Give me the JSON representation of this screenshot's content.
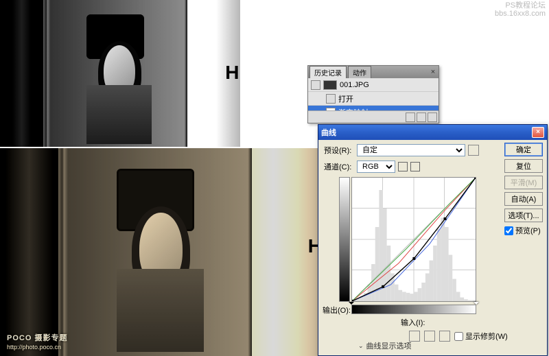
{
  "watermark_tr": {
    "l1": "PS教程论坛",
    "l2": "bbs.16xx8.com"
  },
  "watermark_bl": {
    "brand": "POCO 摄影专题",
    "url": "http://photo.poco.cn"
  },
  "truck_letter": "H",
  "history": {
    "tab1": "历史记录",
    "tab2": "动作",
    "file": "001.JPG",
    "items": [
      "打开",
      "渐变映射"
    ]
  },
  "dialog": {
    "title": "曲线",
    "preset_lbl": "预设(R):",
    "preset_val": "自定",
    "channel_lbl": "通道(C):",
    "channel_val": "RGB",
    "output_lbl": "输出(O):",
    "input_lbl": "输入(I):",
    "btn_ok": "确定",
    "btn_reset": "复位",
    "btn_smooth": "平滑(M)",
    "btn_auto": "自动(A)",
    "btn_opt": "选项(T)...",
    "chk_preview": "预览(P)",
    "chk_clip": "显示修剪(W)",
    "disp": "曲线显示选项"
  },
  "chart_data": {
    "type": "line",
    "title": "Curves",
    "xlabel": "输入",
    "ylabel": "输出",
    "xlim": [
      0,
      255
    ],
    "ylim": [
      0,
      255
    ],
    "series": [
      {
        "name": "RGB",
        "values": [
          [
            0,
            0
          ],
          [
            64,
            30
          ],
          [
            128,
            88
          ],
          [
            192,
            170
          ],
          [
            255,
            255
          ]
        ]
      },
      {
        "name": "R",
        "values": [
          [
            0,
            0
          ],
          [
            96,
            78
          ],
          [
            192,
            188
          ],
          [
            255,
            255
          ]
        ]
      },
      {
        "name": "G",
        "values": [
          [
            0,
            0
          ],
          [
            112,
            108
          ],
          [
            200,
            200
          ],
          [
            255,
            255
          ]
        ]
      },
      {
        "name": "B",
        "values": [
          [
            0,
            0
          ],
          [
            80,
            34
          ],
          [
            160,
            118
          ],
          [
            255,
            255
          ]
        ]
      }
    ],
    "histogram": [
      2,
      3,
      5,
      9,
      18,
      40,
      80,
      120,
      100,
      60,
      30,
      18,
      12,
      10,
      9,
      8,
      10,
      14,
      20,
      30,
      44,
      60,
      78,
      90,
      80,
      50,
      24,
      10,
      4,
      2,
      1,
      1
    ]
  }
}
